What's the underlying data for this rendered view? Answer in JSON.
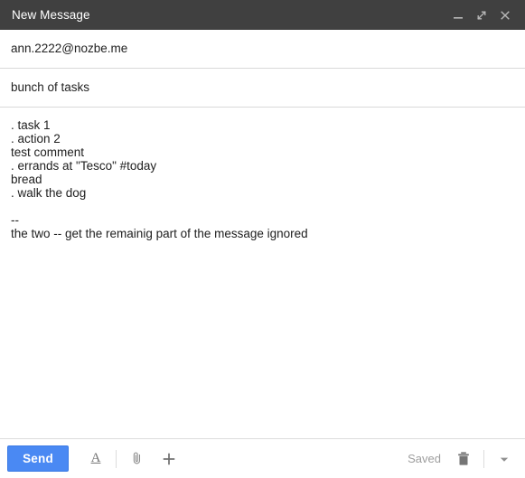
{
  "window": {
    "title": "New Message",
    "controls": [
      {
        "name": "minimize",
        "icon": "minimize-icon",
        "label": "_"
      },
      {
        "name": "expand",
        "icon": "expand-icon",
        "label": ""
      },
      {
        "name": "close",
        "icon": "close-icon",
        "label": "×"
      }
    ]
  },
  "compose": {
    "to": {
      "value": "ann.2222@nozbe.me",
      "placeholder": "Recipients"
    },
    "subject": {
      "value": "bunch of tasks",
      "placeholder": "Subject"
    },
    "body": {
      "value": ". task 1\n. action 2\ntest comment\n. errands at \"Tesco\" #today\nbread\n. walk the dog\n\n--\nthe two -- get the remainig part of the message ignored",
      "placeholder": ""
    }
  },
  "toolbar": {
    "send_label": "Send",
    "format_label": "A",
    "attach_icon": "paperclip-icon",
    "insert_icon": "plus-icon",
    "saved_label": "Saved",
    "discard_icon": "trash-icon",
    "more_icon": "chevron-down-icon"
  },
  "colors": {
    "titlebar_bg": "#404040",
    "send_button_bg": "#4a89f3",
    "divider": "#d9d9d9",
    "saved_text": "#9e9e9e",
    "body_text": "#202020"
  }
}
